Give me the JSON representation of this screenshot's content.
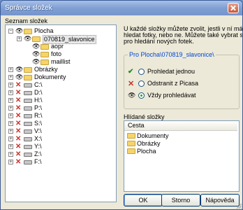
{
  "window": {
    "title": "Správce složek"
  },
  "left_panel": {
    "label": "Seznam složek"
  },
  "tree": [
    {
      "label": "Plocha",
      "indent": 0,
      "state": "eye",
      "icon": "folder",
      "expand": "−"
    },
    {
      "label": "070819_slavonice",
      "indent": 1,
      "state": "eye",
      "icon": "folder",
      "expand": "+",
      "selected": true
    },
    {
      "label": "aopr",
      "indent": 2,
      "state": "eye",
      "icon": "folder",
      "expand": ""
    },
    {
      "label": "foto",
      "indent": 2,
      "state": "eye",
      "icon": "folder",
      "expand": ""
    },
    {
      "label": "maillist",
      "indent": 2,
      "state": "eye",
      "icon": "folder",
      "expand": ""
    },
    {
      "label": "Obrázky",
      "indent": 0,
      "state": "eye",
      "icon": "folder",
      "expand": "+"
    },
    {
      "label": "Dokumenty",
      "indent": 0,
      "state": "eye",
      "icon": "folder",
      "expand": "+"
    },
    {
      "label": "C:\\",
      "indent": 0,
      "state": "x",
      "icon": "drive",
      "expand": "+"
    },
    {
      "label": "D:\\",
      "indent": 0,
      "state": "x",
      "icon": "drive",
      "expand": "+"
    },
    {
      "label": "H:\\",
      "indent": 0,
      "state": "x",
      "icon": "drive",
      "expand": "+"
    },
    {
      "label": "P:\\",
      "indent": 0,
      "state": "x",
      "icon": "drive",
      "expand": "+"
    },
    {
      "label": "R:\\",
      "indent": 0,
      "state": "x",
      "icon": "drive",
      "expand": "+"
    },
    {
      "label": "S:\\",
      "indent": 0,
      "state": "x",
      "icon": "drive",
      "expand": "+"
    },
    {
      "label": "V:\\",
      "indent": 0,
      "state": "x",
      "icon": "drive",
      "expand": "+"
    },
    {
      "label": "X:\\",
      "indent": 0,
      "state": "x",
      "icon": "drive",
      "expand": "+"
    },
    {
      "label": "Y:\\",
      "indent": 0,
      "state": "x",
      "icon": "drive",
      "expand": "+"
    },
    {
      "label": "Z:\\",
      "indent": 0,
      "state": "x",
      "icon": "drive",
      "expand": "+"
    },
    {
      "label": "F:\\",
      "indent": 0,
      "state": "x",
      "icon": "drive",
      "expand": "+"
    }
  ],
  "help": {
    "line1": "U každé složky můžete zvolit, jestli v ní má Picasa",
    "line2": "hledat fotky, nebo ne.  Můžete také vybrat složky",
    "line3": "pro hledání nových fotek."
  },
  "group": {
    "title": "Pro Plocha\\070819_slavonice\\"
  },
  "options": [
    {
      "label": "Prohledat jednou",
      "icon": "checkmark-icon",
      "icon_color": "#2a8a2a",
      "checked": false
    },
    {
      "label": "Odstranit z Picasa",
      "icon": "x-icon",
      "icon_color": "#c8322a",
      "checked": false
    },
    {
      "label": "Vždy prohledávat",
      "icon": "eye-icon",
      "icon_color": "#222222",
      "checked": true
    }
  ],
  "watched": {
    "label": "Hlídané složky",
    "column": "Cesta",
    "items": [
      "Dokumenty",
      "Obrázky",
      "Plocha"
    ]
  },
  "buttons": {
    "ok": "OK",
    "cancel": "Storno",
    "help": "Nápověda"
  }
}
